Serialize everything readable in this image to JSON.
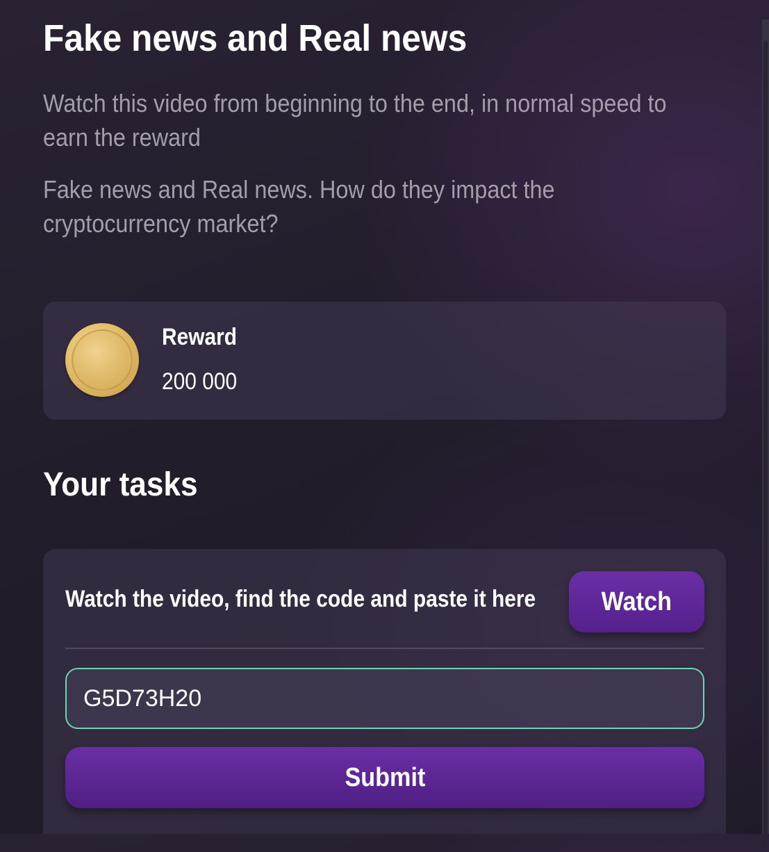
{
  "header": {
    "title": "Fake news and Real news",
    "instructions": "Watch this video from beginning to the end, in normal speed to earn the reward",
    "description": "Fake news and Real news. How do they impact the cryptocurrency market?"
  },
  "reward": {
    "icon": "gold-coin-icon",
    "label": "Reward",
    "value": "200 000"
  },
  "tasks": {
    "section_title": "Your tasks",
    "task_text": "Watch the video, find the code and paste it here",
    "watch_label": "Watch",
    "code_value": "G5D73H20",
    "submit_label": "Submit"
  },
  "colors": {
    "accent_purple": "#5e2899",
    "input_border": "#6fd3b4",
    "muted_text": "#a49eab",
    "coin_gold": "#e2bd6a"
  }
}
